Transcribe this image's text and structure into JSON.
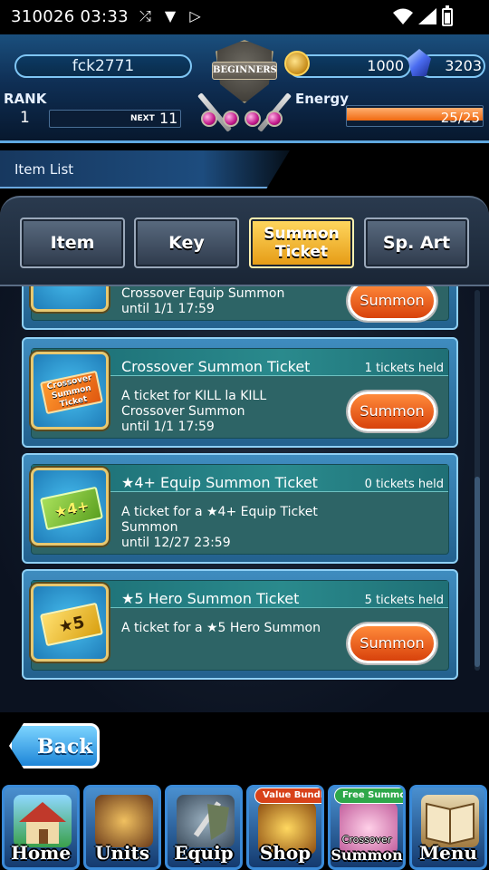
{
  "status_bar": {
    "time": "310026 03:33",
    "icons_left": [
      "shuffle-icon",
      "download-icon",
      "play-icon"
    ],
    "icons_right": [
      "wifi-icon",
      "signal-icon",
      "battery-icon"
    ]
  },
  "header": {
    "player_name": "fck2771",
    "badge_text": "BEGINNERS",
    "rank_label": "RANK",
    "rank_value": "1",
    "next_label": "NEXT",
    "next_value": "11",
    "gil": "1000",
    "crystals": "3203",
    "energy_label": "Energy",
    "energy_value": "25/25",
    "energy_fraction": 1.0
  },
  "section_title": "Item List",
  "tabs": [
    {
      "label": "Item",
      "active": false
    },
    {
      "label": "Key",
      "active": false
    },
    {
      "label": "Summon Ticket",
      "active": true
    },
    {
      "label": "Sp. Art",
      "active": false
    }
  ],
  "partial_card": {
    "desc_line1": "Crossover Equip Summon",
    "desc_line2": "until 1/1 17:59",
    "button": "Summon"
  },
  "cards": [
    {
      "title": "Crossover Summon Ticket",
      "held": "1 tickets held",
      "desc_line1": "A ticket for KILL la KILL",
      "desc_line2": "Crossover Summon",
      "desc_line3": "until 1/1 17:59",
      "ticket_text": "Crossover Summon Ticket",
      "button": "Summon"
    },
    {
      "title": "★4+ Equip Summon Ticket",
      "held": "0 tickets held",
      "desc_line1": "A ticket for a ★4+ Equip Ticket",
      "desc_line2": "Summon",
      "desc_line3": "until 12/27 23:59",
      "ticket_text": "★4+",
      "button": ""
    },
    {
      "title": "★5 Hero Summon Ticket",
      "held": "5 tickets held",
      "desc_line1": "A ticket for a ★5 Hero Summon",
      "desc_line2": "",
      "desc_line3": "",
      "ticket_text": "★5",
      "button": "Summon"
    }
  ],
  "back_button": "Back",
  "bottom_nav": [
    {
      "label": "Home"
    },
    {
      "label": "Units"
    },
    {
      "label": "Equip"
    },
    {
      "label": "Shop",
      "badge": "Value Bundle"
    },
    {
      "label": "Summon",
      "sublabel": "Crossover",
      "badge": "Free Summon"
    },
    {
      "label": "Menu"
    }
  ],
  "colors": {
    "accent_blue": "#3a8ad8",
    "active_tab": "#ffd860",
    "summon_orange": "#e8581a",
    "card_teal": "#2d6466",
    "energy_orange": "#f06a10"
  }
}
